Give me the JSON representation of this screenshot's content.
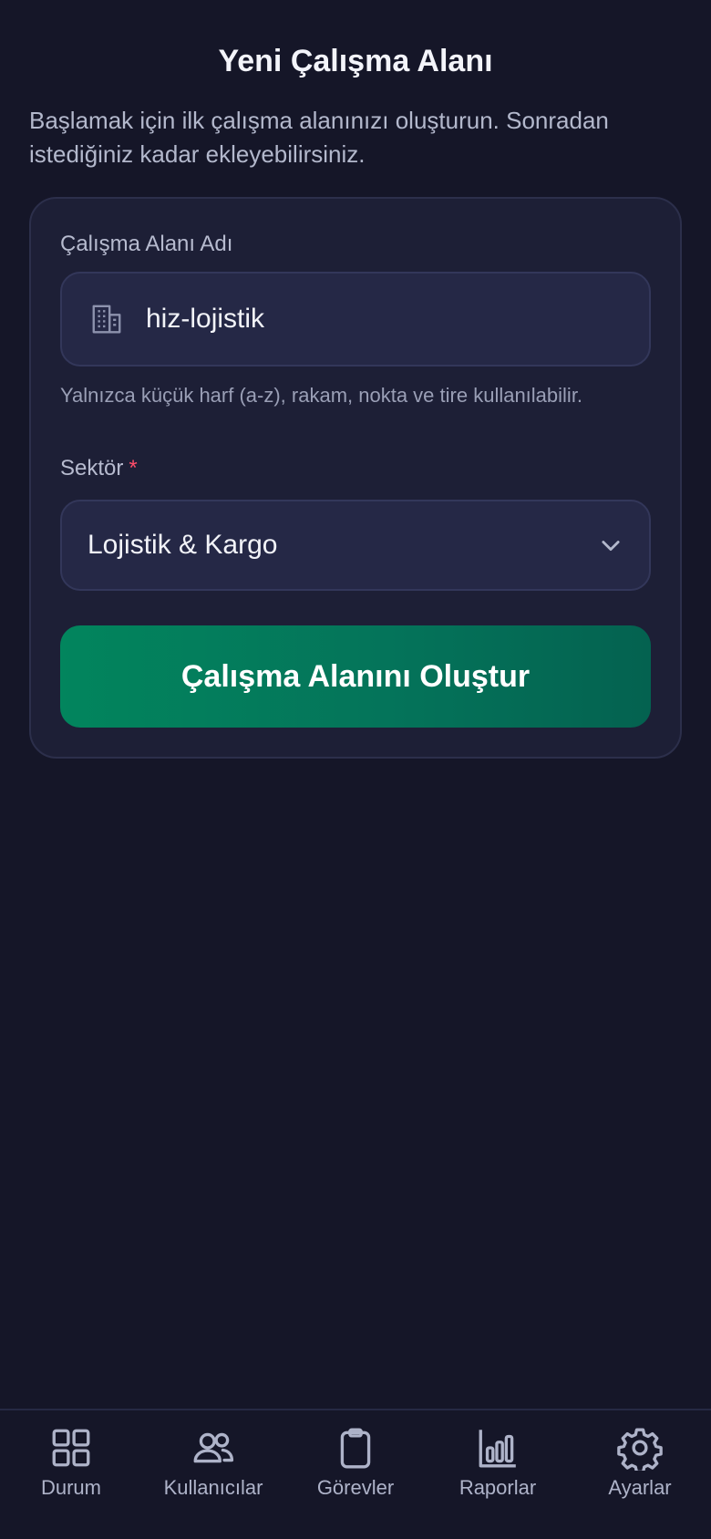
{
  "header": {
    "title": "Yeni Çalışma Alanı",
    "subtitle": "Başlamak için ilk çalışma alanınızı oluşturun. Sonradan istediğiniz kadar ekleyebilirsiniz."
  },
  "form": {
    "workspace_name": {
      "label": "Çalışma Alanı Adı",
      "value": "hiz-lojistik",
      "icon": "building-icon",
      "hint": "Yalnızca küçük harf (a-z), rakam, nokta ve tire kullanılabilir."
    },
    "sector": {
      "label": "Sektör",
      "required_mark": "*",
      "selected": "Lojistik & Kargo",
      "icon": "chevron-down-icon"
    },
    "submit_label": "Çalışma Alanını Oluştur"
  },
  "tabbar": {
    "items": [
      {
        "label": "Durum",
        "icon": "grid-icon"
      },
      {
        "label": "Kullanıcılar",
        "icon": "users-icon"
      },
      {
        "label": "Görevler",
        "icon": "clipboard-icon"
      },
      {
        "label": "Raporlar",
        "icon": "bar-chart-icon"
      },
      {
        "label": "Ayarlar",
        "icon": "gear-icon"
      }
    ]
  },
  "colors": {
    "background": "#151628",
    "card": "#1d1f36",
    "accent": "#02855d",
    "required": "#ff4d6a"
  }
}
